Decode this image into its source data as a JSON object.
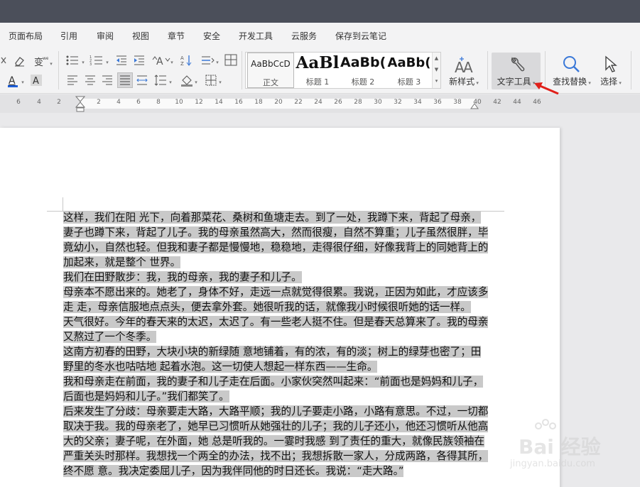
{
  "menu": {
    "items": [
      "页面布局",
      "引用",
      "审阅",
      "视图",
      "章节",
      "安全",
      "开发工具",
      "云服务",
      "保存到云笔记"
    ]
  },
  "styles": {
    "samples": [
      {
        "sample": "AaBbCcD",
        "caption": "正文"
      },
      {
        "sample": "AaBl",
        "caption": "标题 1"
      },
      {
        "sample": "AaBb(",
        "caption": "标题 2"
      },
      {
        "sample": "AaBb(",
        "caption": "标题 3"
      }
    ]
  },
  "toolbar": {
    "new_style_label": "新样式",
    "text_tools_label": "文字工具",
    "find_replace_label": "查找替换",
    "select_label": "选择"
  },
  "ruler": {
    "numbers": [
      "6",
      "4",
      "2",
      "2",
      "4",
      "6",
      "8",
      "10",
      "12",
      "14",
      "16",
      "18",
      "20",
      "22",
      "24",
      "26",
      "28",
      "30",
      "32",
      "34",
      "36",
      "38",
      "40",
      "42",
      "44",
      "46"
    ]
  },
  "document": {
    "paragraphs": [
      "这样，我们在阳 光下，向着那菜花、桑树和鱼塘走去。到了一处，我蹲下来，背起了母亲，妻子也蹲下来，背起了儿子。我的母亲虽然高大，然而很瘦，自然不算重；儿子虽然很胖，毕竟幼小，自然也轻。但我和妻子都是慢慢地，稳稳地，走得很仔细，好像我背上的同她背上的加起来，就是整个 世界。",
      "我们在田野散步：我，我的母亲，我的妻子和儿子。",
      "母亲本不愿出来的。她老了，身体不好，走远一点就觉得很累。我说，正因为如此，才应该多走 走，母亲信服地点点头，便去拿外套。她很听我的话，就像我小时候很听她的话一样。",
      "天气很好。今年的春天来的太迟，太迟了。有一些老人挺不住。但是春天总算来了。我的母亲又熬过了一个冬季。",
      "这南方初春的田野，大块小块的新绿随 意地铺着，有的浓，有的淡；树上的绿芽也密了；田野里的冬水也咕咕地 起着水泡。这一切使人想起一样东西——生命。",
      "我和母亲走在前面，我的妻子和儿子走在后面。小家伙突然叫起来：“前面也是妈妈和儿子，后面也是妈妈和儿子。”我们都笑了。",
      "后来发生了分歧：母亲要走大路，大路平顺；我的儿子要走小路，小路有意思。不过，一切都取决于我。我的母亲老了，她早已习惯听从她强壮的儿子；我的儿子还小，他还习惯听从他高大的父亲；妻子呢，在外面，她 总是听我的。一霎时我感  到了责任的重大，就像民族领袖在严重关头时那样。我想找一个两全的办法，找不出；我想拆散一家人，分成两路，各得其所，终不愿  意。我决定委屈儿子，因为我伴同他的时日还长。我说：“走大路。”"
    ]
  },
  "watermark": {
    "brand": "Bai",
    "brand_cn": "经验",
    "url": "jingyan.baidu.com"
  },
  "colors": {
    "titlebar": "#4b4f5a",
    "highlight": "#c9c9c9",
    "arrow": "#e0201a",
    "font_color_a": "#1f5fd6"
  }
}
